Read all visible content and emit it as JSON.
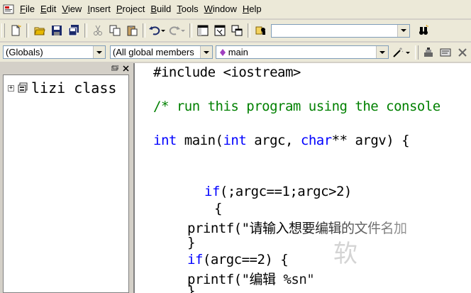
{
  "menubar": {
    "items": [
      {
        "label": "File",
        "u": "F"
      },
      {
        "label": "Edit",
        "u": "E"
      },
      {
        "label": "View",
        "u": "V"
      },
      {
        "label": "Insert",
        "u": "I"
      },
      {
        "label": "Project",
        "u": "P"
      },
      {
        "label": "Build",
        "u": "B"
      },
      {
        "label": "Tools",
        "u": "T"
      },
      {
        "label": "Window",
        "u": "W"
      },
      {
        "label": "Help",
        "u": "H"
      }
    ]
  },
  "toolbar": {
    "find_value": ""
  },
  "wizardbar": {
    "scope": "(Globals)",
    "filter": "(All global members",
    "member": "main"
  },
  "workspace": {
    "tree_item": "lizi class"
  },
  "editor": {
    "lines": [
      "#include <iostream>",
      "/* run this program using the console",
      "int main(int argc, char** argv) {",
      "if(;argc==1;argc>2)",
      "{",
      "printf(\"请输入想要编辑的文件名加",
      "}",
      "if(argc==2) {",
      "printf(\"编辑 %sn\"",
      "}"
    ]
  },
  "watermark": "软",
  "colors": {
    "keyword": "#0000ff",
    "comment": "#008000"
  }
}
